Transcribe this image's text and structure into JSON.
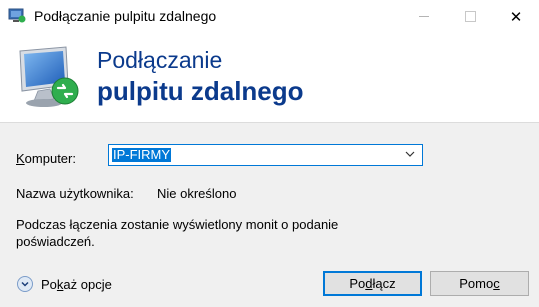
{
  "window": {
    "title": "Podłączanie pulpitu zdalnego",
    "close_glyph": "✕"
  },
  "header": {
    "line1": "Podłączanie",
    "line2": "pulpitu zdalnego"
  },
  "form": {
    "computer_label": "Komputer:",
    "computer_label_accesskey": "K",
    "computer_label_rest": "omputer:",
    "computer_value": "IP-FIRMY",
    "username_label": "Nazwa użytkownika:",
    "username_value": "Nie określono",
    "info_text": "Podczas łączenia zostanie wyświetlony monit o podanie poświadczeń."
  },
  "options": {
    "label_pre": "Po",
    "label_accesskey": "k",
    "label_post": "aż opcje"
  },
  "buttons": {
    "connect_pre": "Po",
    "connect_accesskey": "d",
    "connect_post": "łącz",
    "help_pre": "Pomo",
    "help_accesskey": "c",
    "help_post": ""
  },
  "colors": {
    "accent": "#0078d7",
    "header_text": "#0b3a8c",
    "background": "#f0f0f0"
  },
  "icons": {
    "app": "remote-desktop-icon",
    "dropdown": "chevron-down-icon",
    "options": "expand-circle-icon"
  }
}
